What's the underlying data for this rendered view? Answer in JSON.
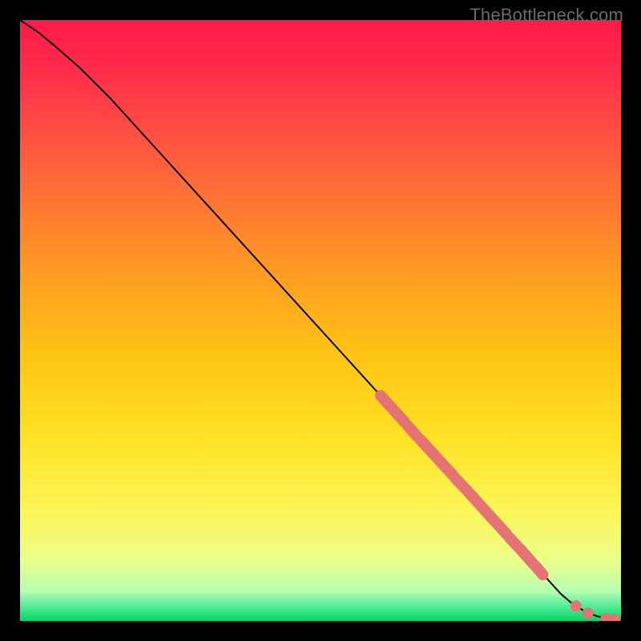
{
  "watermark": "TheBottleneck.com",
  "chart_data": {
    "type": "line",
    "title": "",
    "xlabel": "",
    "ylabel": "",
    "xlim": [
      0,
      100
    ],
    "ylim": [
      0,
      100
    ],
    "gradient_colors": {
      "top": "#ff1744",
      "upper_mid": "#ff6e40",
      "mid": "#ffc107",
      "lower_mid": "#ffee58",
      "lower": "#f4ff81",
      "bottom": "#00e676"
    },
    "curve": {
      "x": [
        0,
        3,
        6,
        10,
        15,
        20,
        30,
        40,
        50,
        60,
        65,
        70,
        75,
        80,
        85,
        88,
        90,
        92,
        94,
        96,
        98,
        100
      ],
      "y": [
        100,
        98,
        95.5,
        92,
        87,
        81.5,
        70.5,
        59.5,
        48.5,
        37.5,
        32,
        26.5,
        21,
        15.5,
        10,
        6.7,
        4.5,
        2.8,
        1.6,
        0.8,
        0.3,
        0.2
      ]
    },
    "highlight_segments": [
      {
        "x1": 60,
        "y1": 37.5,
        "x2": 64,
        "y2": 33.1
      },
      {
        "x1": 64.5,
        "y1": 32.5,
        "x2": 66,
        "y2": 30.8
      },
      {
        "x1": 66.5,
        "y1": 30.3,
        "x2": 72,
        "y2": 24.3
      },
      {
        "x1": 72.5,
        "y1": 23.7,
        "x2": 74,
        "y2": 22.1
      },
      {
        "x1": 74.3,
        "y1": 21.8,
        "x2": 79,
        "y2": 16.6
      },
      {
        "x1": 79.3,
        "y1": 16.3,
        "x2": 81,
        "y2": 14.4
      },
      {
        "x1": 81.5,
        "y1": 13.8,
        "x2": 83,
        "y2": 12.2
      },
      {
        "x1": 83.3,
        "y1": 11.9,
        "x2": 85.5,
        "y2": 9.4
      },
      {
        "x1": 85.8,
        "y1": 9.1,
        "x2": 87,
        "y2": 7.7
      }
    ],
    "highlight_dots": [
      {
        "x": 92.5,
        "y": 2.5
      },
      {
        "x": 94.5,
        "y": 1.3
      },
      {
        "x": 97.5,
        "y": 0.4
      },
      {
        "x": 99,
        "y": 0.25
      }
    ],
    "highlight_color": "#e57373"
  }
}
